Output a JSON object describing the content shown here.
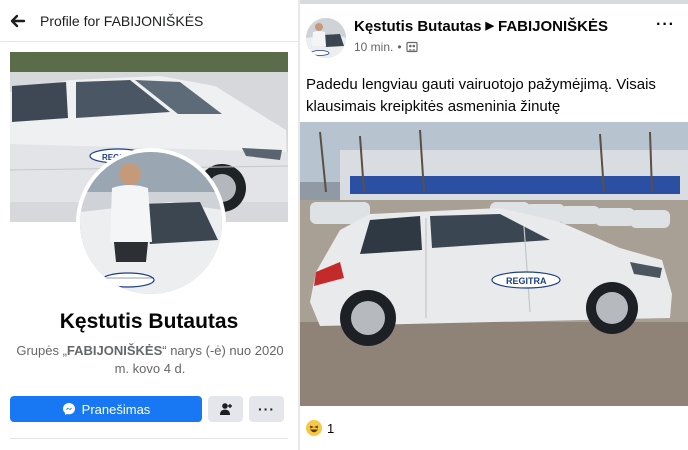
{
  "left_panel": {
    "title": "Profile for FABIJONIŠKĖS",
    "profile_name": "Kęstutis Butautas",
    "group_prefix": "Grupės „",
    "group_name": "FABIJONIŠKĖS",
    "group_suffix": "“ narys (-ė) nuo 2020 m. kovo 4 d.",
    "message_button_label": "Pranešimas",
    "more_label": "···",
    "cover_logo_text": "REGITRA"
  },
  "right_panel": {
    "author": "Kęstutis Butautas",
    "group": "FABIJONIŠKĖS",
    "time": "10 min.",
    "separator": "•",
    "more_label": "···",
    "post_text": "Padedu lengviau gauti vairuotojo pažymėjimą. Visais klausimais kreipkitės asmeninia žinutę",
    "photo_logo_text": "REGITRA",
    "reaction_count": "1"
  },
  "icons": {
    "back": "arrow-left-icon",
    "messenger": "messenger-icon",
    "friend": "add-friend-icon",
    "privacy": "group-privacy-icon",
    "reaction": "haha-reaction-icon"
  },
  "colors": {
    "accent": "#1877f2",
    "secondary_button": "#e4e6eb",
    "muted_text": "#65676b",
    "divider": "#e4e6eb"
  }
}
